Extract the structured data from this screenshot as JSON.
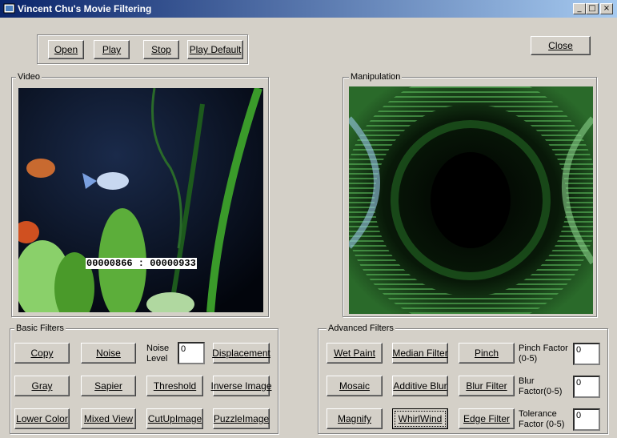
{
  "window": {
    "title": "Vincent Chu's Movie Filtering",
    "minimize": "_",
    "maximize": "□",
    "close": "×"
  },
  "toolbar": {
    "open": "Open",
    "play": "Play",
    "stop": "Stop",
    "play_default": "Play Default",
    "close": "Close"
  },
  "panels": {
    "video_label": "Video",
    "manipulation_label": "Manipulation",
    "frame_counter": "00000866 : 00000933"
  },
  "basic_filters": {
    "label": "Basic Filters",
    "copy": "Copy",
    "noise": "Noise",
    "noise_level_label": "Noise Level",
    "noise_level_value": "0",
    "displacement": "Displacement",
    "gray": "Gray",
    "sapier": "Sapier",
    "threshold": "Threshold",
    "inverse_image": "Inverse Image",
    "lower_color": "Lower Color",
    "mixed_view": "Mixed View",
    "cut_up_image": "CutUpImage",
    "puzzle_image": "PuzzleImage"
  },
  "advanced_filters": {
    "label": "Advanced Filters",
    "wet_paint": "Wet Paint",
    "median_filter": "Median Filter",
    "pinch": "Pinch",
    "pinch_factor_label": "Pinch Factor (0-5)",
    "pinch_factor_value": "0",
    "mosaic": "Mosaic",
    "additive_blur": "Additive Blur",
    "blur_filter": "Blur Filter",
    "blur_factor_label": "Blur Factor(0-5)",
    "blur_factor_value": "0",
    "magnify": "Magnify",
    "whirlwind": "WhirlWind",
    "edge_filter": "Edge Filter",
    "tolerance_factor_label": "Tolerance Factor (0-5)",
    "tolerance_factor_value": "0"
  },
  "colors": {
    "titlebar_start": "#0a246a",
    "titlebar_end": "#a6caf0",
    "face": "#d4d0c8"
  }
}
